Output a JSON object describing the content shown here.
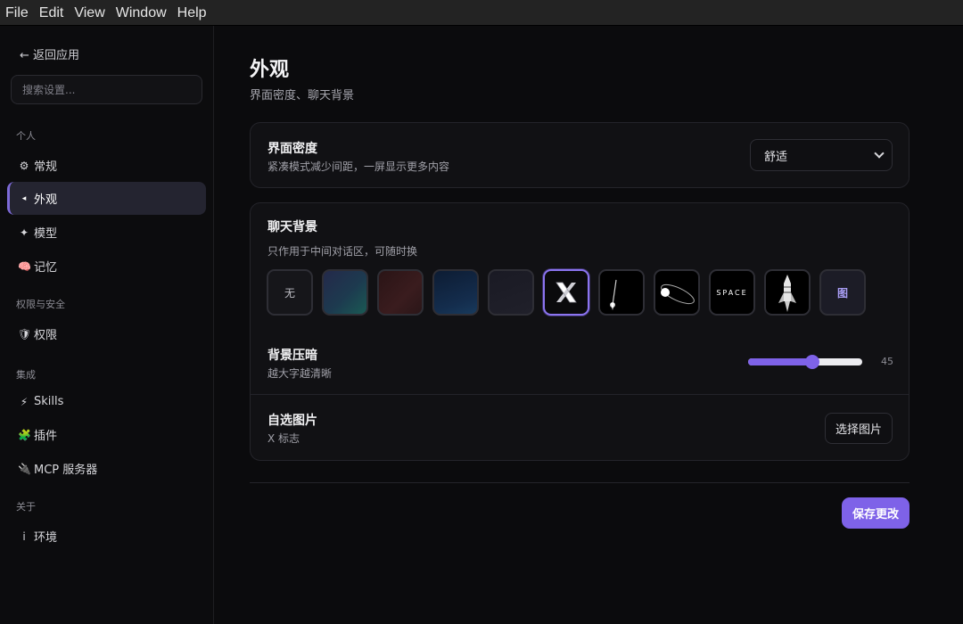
{
  "menubar": {
    "items": [
      "File",
      "Edit",
      "View",
      "Window",
      "Help"
    ]
  },
  "sidebar": {
    "back_label": "← 返回应用",
    "search_placeholder": "搜索设置...",
    "sections": {
      "personal": "个人",
      "security": "权限与安全",
      "integration": "集成",
      "about": "关于"
    },
    "items": [
      {
        "icon": "⚙",
        "label": "常规"
      },
      {
        "icon": "◂",
        "label": "外观"
      },
      {
        "icon": "✦",
        "label": "模型"
      },
      {
        "icon": "🧠",
        "label": "记忆"
      },
      {
        "icon": "🛡",
        "label": "权限"
      },
      {
        "icon": "⚡",
        "label": "Skills"
      },
      {
        "icon": "🧩",
        "label": "插件"
      },
      {
        "icon": "🔌",
        "label": "MCP 服务器"
      },
      {
        "icon": "i",
        "label": "环境"
      }
    ]
  },
  "page": {
    "title": "外观",
    "subtitle": "界面密度、聊天背景"
  },
  "density": {
    "title": "界面密度",
    "desc": "紧凑模式减少间距，一屏显示更多内容",
    "value": "舒适"
  },
  "background": {
    "title": "聊天背景",
    "desc": "只作用于中间对话区，可随时换",
    "none_label": "无",
    "space_text": "SPACE",
    "pick_label": "图",
    "dim_title": "背景压暗",
    "dim_desc": "越大字越清晰",
    "dim_value": "45",
    "dim_fraction": 0.56,
    "custom_title": "自选图片",
    "custom_desc": "X 标志",
    "custom_button": "选择图片"
  },
  "footer": {
    "save_label": "保存更改"
  },
  "colors": {
    "accent": "#7e62e8",
    "card": "#111114",
    "background": "#0b0b0d"
  }
}
